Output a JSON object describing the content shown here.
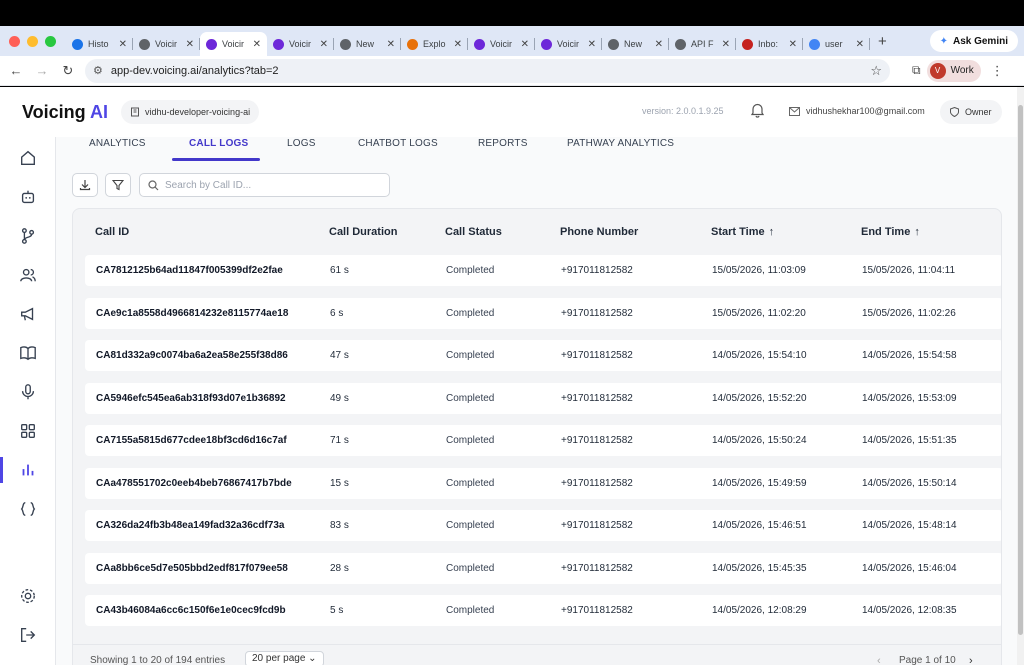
{
  "browser": {
    "tabs": [
      {
        "label": "Histo",
        "fav": "history-icon",
        "color": "#1a73e8"
      },
      {
        "label": "Voicir",
        "fav": "plus-icon",
        "color": "#5f6368"
      },
      {
        "label": "Voicir",
        "fav": "voicing-icon",
        "color": "#6d28d9",
        "active": true
      },
      {
        "label": "Voicir",
        "fav": "voicing-icon",
        "color": "#6d28d9"
      },
      {
        "label": "New",
        "fav": "plus-icon",
        "color": "#5f6368"
      },
      {
        "label": "Explo",
        "fav": "explore-icon",
        "color": "#e8710a"
      },
      {
        "label": "Voicir",
        "fav": "voicing-icon",
        "color": "#6d28d9"
      },
      {
        "label": "Voicir",
        "fav": "voicing-icon",
        "color": "#6d28d9"
      },
      {
        "label": "New",
        "fav": "plus-icon",
        "color": "#5f6368"
      },
      {
        "label": "API F",
        "fav": "plus-icon",
        "color": "#5f6368"
      },
      {
        "label": "Inbo:",
        "fav": "gmail-icon",
        "color": "#c5221f"
      },
      {
        "label": "user",
        "fav": "google-icon",
        "color": "#4285f4"
      }
    ],
    "ask_gemini": "Ask Gemini",
    "url": "app-dev.voicing.ai/analytics?tab=2",
    "profile_initial": "V",
    "profile_label": "Work"
  },
  "header": {
    "logo_main": "Voicing",
    "logo_accent": "AI",
    "workspace": "vidhu-developer-voicing-ai",
    "version": "version: 2.0.0.1.9.25",
    "email": "vidhushekhar100@gmail.com",
    "role": "Owner"
  },
  "sidebar": [
    "home-icon",
    "bot-icon",
    "branch-icon",
    "users-icon",
    "megaphone-icon",
    "book-icon",
    "mic-icon",
    "grid-icon",
    "analytics-icon",
    "braces-icon",
    "settings-icon",
    "logout-icon"
  ],
  "tabs": [
    "ANALYTICS",
    "CALL LOGS",
    "LOGS",
    "CHATBOT LOGS",
    "REPORTS",
    "PATHWAY ANALYTICS"
  ],
  "active_tab": "CALL LOGS",
  "search": {
    "placeholder": "Search by Call ID..."
  },
  "table": {
    "columns": [
      "Call ID",
      "Call Duration",
      "Call Status",
      "Phone Number",
      "Start Time",
      "End Time"
    ],
    "rows": [
      [
        "CA7812125b64ad11847f005399df2e2fae",
        "61 s",
        "Completed",
        "+917011812582",
        "15/05/2026, 11:03:09",
        "15/05/2026, 11:04:11"
      ],
      [
        "CAe9c1a8558d4966814232e8115774ae18",
        "6 s",
        "Completed",
        "+917011812582",
        "15/05/2026, 11:02:20",
        "15/05/2026, 11:02:26"
      ],
      [
        "CA81d332a9c0074ba6a2ea58e255f38d86",
        "47 s",
        "Completed",
        "+917011812582",
        "14/05/2026, 15:54:10",
        "14/05/2026, 15:54:58"
      ],
      [
        "CA5946efc545ea6ab318f93d07e1b36892",
        "49 s",
        "Completed",
        "+917011812582",
        "14/05/2026, 15:52:20",
        "14/05/2026, 15:53:09"
      ],
      [
        "CA7155a5815d677cdee18bf3cd6d16c7af",
        "71 s",
        "Completed",
        "+917011812582",
        "14/05/2026, 15:50:24",
        "14/05/2026, 15:51:35"
      ],
      [
        "CAa478551702c0eeb4beb76867417b7bde",
        "15 s",
        "Completed",
        "+917011812582",
        "14/05/2026, 15:49:59",
        "14/05/2026, 15:50:14"
      ],
      [
        "CA326da24fb3b48ea149fad32a36cdf73a",
        "83 s",
        "Completed",
        "+917011812582",
        "14/05/2026, 15:46:51",
        "14/05/2026, 15:48:14"
      ],
      [
        "CAa8bb6ce5d7e505bbd2edf817f079ee58",
        "28 s",
        "Completed",
        "+917011812582",
        "14/05/2026, 15:45:35",
        "14/05/2026, 15:46:04"
      ],
      [
        "CA43b46084a6cc6c150f6e1e0cec9fcd9b",
        "5 s",
        "Completed",
        "+917011812582",
        "14/05/2026, 12:08:29",
        "14/05/2026, 12:08:35"
      ]
    ]
  },
  "footer": {
    "entries": "Showing 1 to 20 of 194 entries",
    "per_page": "20 per page",
    "page": "Page 1 of 10"
  },
  "colors": {
    "accent": "#4f46e5"
  }
}
